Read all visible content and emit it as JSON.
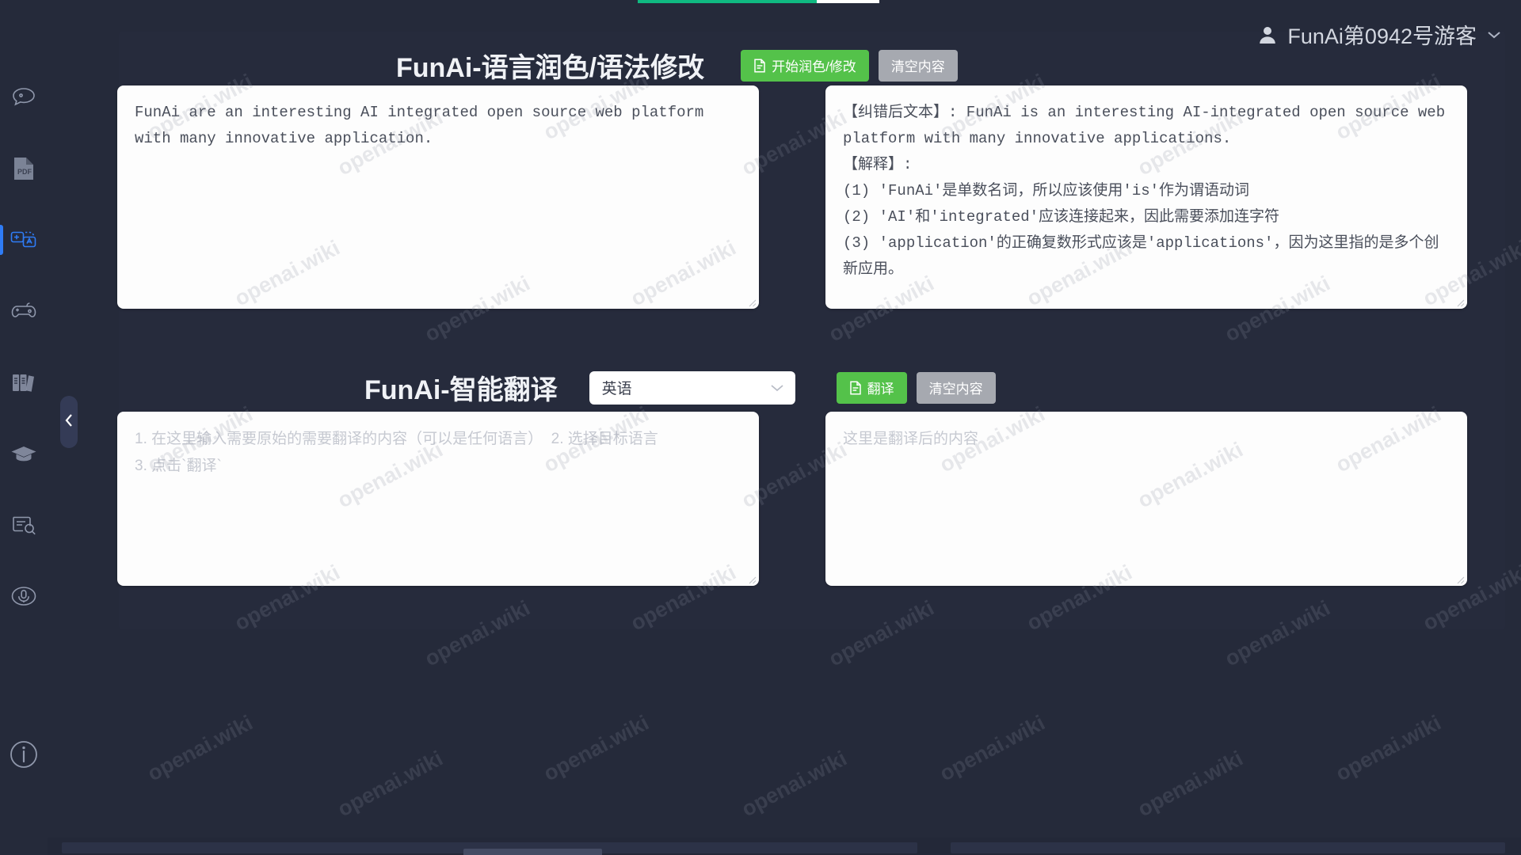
{
  "app": {
    "user_label": "FunAi第0942号游客",
    "avatar_icon": "user-icon",
    "caret_icon": "chevron-down-icon",
    "watermark_text": "openai.wiki"
  },
  "sidebar": {
    "items": [
      {
        "icon": "chat-bubble-icon",
        "active": false
      },
      {
        "icon": "pdf-file-icon",
        "active": false
      },
      {
        "icon": "translate-language-icon",
        "active": true
      },
      {
        "icon": "game-controller-icon",
        "active": false
      },
      {
        "icon": "books-library-icon",
        "active": false
      },
      {
        "icon": "graduation-cap-icon",
        "active": false
      },
      {
        "icon": "document-search-icon",
        "active": false
      },
      {
        "icon": "microphone-icon",
        "active": false
      }
    ],
    "bottom_item": {
      "icon": "info-icon"
    },
    "collapse": {
      "icon": "chevron-left-icon"
    }
  },
  "polish": {
    "title": "FunAi-语言润色/语法修改",
    "run_button": {
      "label": "开始润色/修改",
      "icon": "document-icon",
      "color": "#54c24a"
    },
    "clear_button": {
      "label": "清空内容",
      "color": "#a6a9b0"
    },
    "input_value": "FunAi are an interesting AI integrated open source web platform with many innovative application.",
    "output_value": "【纠错后文本】: FunAi is an interesting AI-integrated open source web platform with many innovative applications.\n【解释】:\n(1) 'FunAi'是单数名词，所以应该使用'is'作为谓语动词\n(2) 'AI'和'integrated'应该连接起来，因此需要添加连字符\n(3) 'application'的正确复数形式应该是'applications'，因为这里指的是多个创新应用。"
  },
  "translate": {
    "title": "FunAi-智能翻译",
    "language_select": {
      "value": "英语",
      "icon": "chevron-down-icon"
    },
    "run_button": {
      "label": "翻译",
      "icon": "document-icon",
      "color": "#54c24a"
    },
    "clear_button": {
      "label": "清空内容",
      "color": "#a6a9b0"
    },
    "input_placeholder": "1. 在这里输入需要原始的需要翻译的内容（可以是任何语言）  2. 选择目标语言\n3. 点击`翻译`",
    "output_placeholder": "这里是翻译后的内容"
  },
  "progress": {
    "percent": 74,
    "color": "#10b981"
  }
}
